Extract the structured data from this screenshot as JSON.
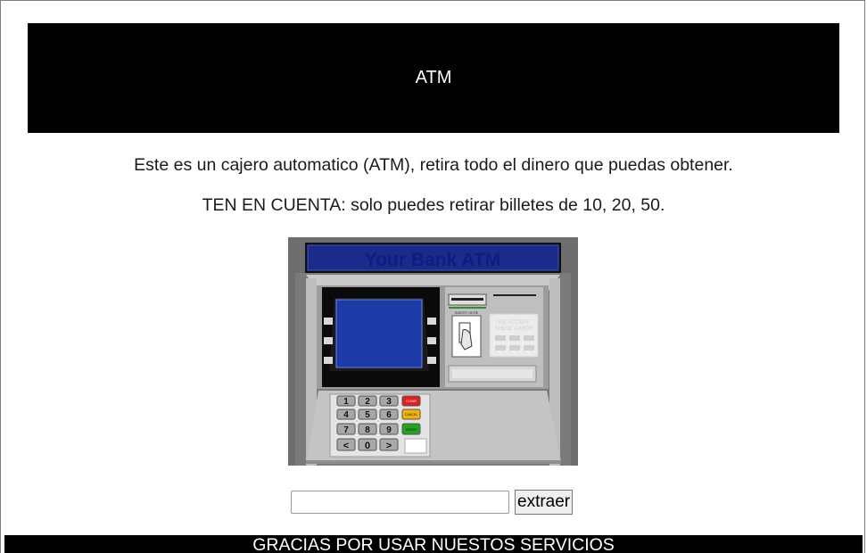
{
  "header": {
    "title": "ATM"
  },
  "intro": {
    "description": "Este es un cajero automatico (ATM), retira todo el dinero que puedas obtener.",
    "note": "TEN EN CUENTA: solo puedes retirar billetes de 10, 20, 50."
  },
  "atm_image": {
    "sign": "Your Bank ATM",
    "insert_label": "INSERT HERE",
    "accept_label_line1": "WE ACCEPT",
    "accept_label_line2": "THESE CARDS",
    "keypad": {
      "keys": [
        "1",
        "2",
        "3",
        "4",
        "5",
        "6",
        "7",
        "8",
        "9",
        "<",
        "0",
        ">"
      ],
      "clear": "CLEAR",
      "cancel": "CANCEL",
      "enter": "ENTER"
    }
  },
  "form": {
    "amount_value": "",
    "extract_label": "extraer"
  },
  "footer": {
    "text": "GRACIAS POR USAR NUESTOS SERVICIOS"
  },
  "colors": {
    "header_bg": "#000000",
    "footer_bg": "#000000",
    "atm_screen": "#1c3aa8",
    "atm_sign": "#0a1f9c"
  }
}
